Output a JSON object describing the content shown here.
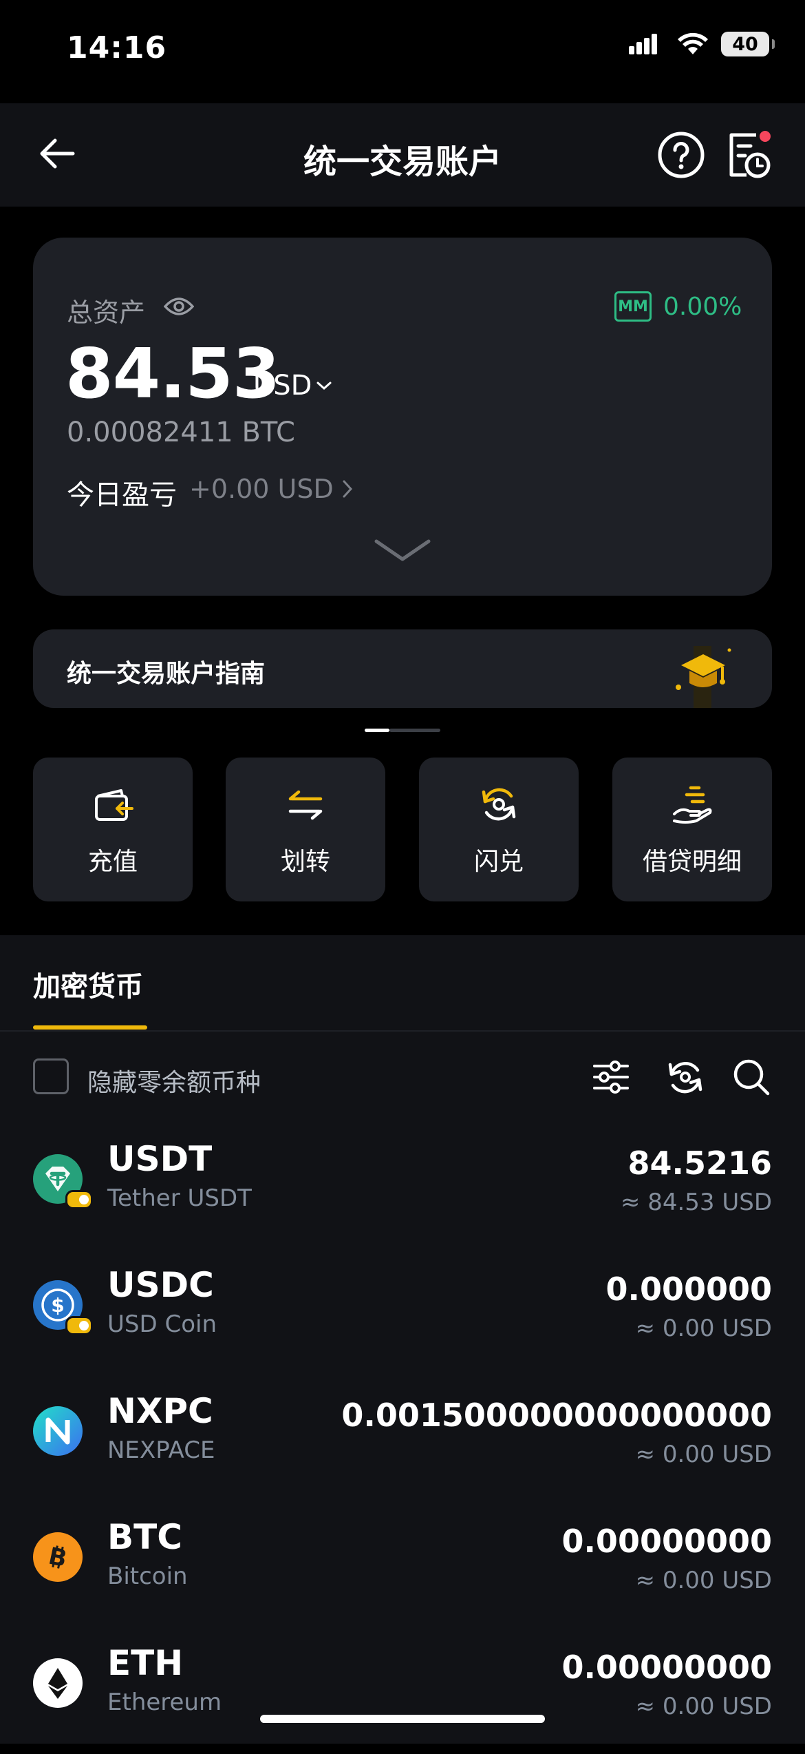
{
  "status": {
    "time": "14:16",
    "battery": "40"
  },
  "nav": {
    "title": "统一交易账户"
  },
  "balance": {
    "total_label": "总资产",
    "mm_badge": "MM",
    "mm_ratio": "0.00%",
    "total_value": "84.53",
    "currency": "USD",
    "btc_equiv": "0.00082411 BTC",
    "pnl_label": "今日盈亏",
    "pnl_value": "+0.00 USD"
  },
  "guide": {
    "title": "统一交易账户指南"
  },
  "actions": [
    {
      "label": "充值",
      "icon": "deposit-icon"
    },
    {
      "label": "划转",
      "icon": "transfer-icon"
    },
    {
      "label": "闪兑",
      "icon": "convert-icon"
    },
    {
      "label": "借贷明细",
      "icon": "loan-icon"
    }
  ],
  "tabs": {
    "crypto": "加密货币"
  },
  "filter": {
    "hide_zero_label": "隐藏零余额币种"
  },
  "coins": [
    {
      "symbol": "USDT",
      "name": "Tether USDT",
      "amount": "84.5216",
      "usd": "≈ 84.53 USD",
      "color": "#26a17b"
    },
    {
      "symbol": "USDC",
      "name": "USD Coin",
      "amount": "0.000000",
      "usd": "≈ 0.00 USD",
      "color": "#2775ca"
    },
    {
      "symbol": "NXPC",
      "name": "NEXPACE",
      "amount": "0.001500000000000000",
      "usd": "≈ 0.00 USD",
      "color": "#1fd1d6"
    },
    {
      "symbol": "BTC",
      "name": "Bitcoin",
      "amount": "0.00000000",
      "usd": "≈ 0.00 USD",
      "color": "#f7931a"
    },
    {
      "symbol": "ETH",
      "name": "Ethereum",
      "amount": "0.00000000",
      "usd": "≈ 0.00 USD",
      "color": "#ffffff"
    }
  ],
  "colors": {
    "accent": "#f0b90b",
    "positive": "#2ebd85",
    "card": "#1e2026",
    "panel": "#111216"
  }
}
